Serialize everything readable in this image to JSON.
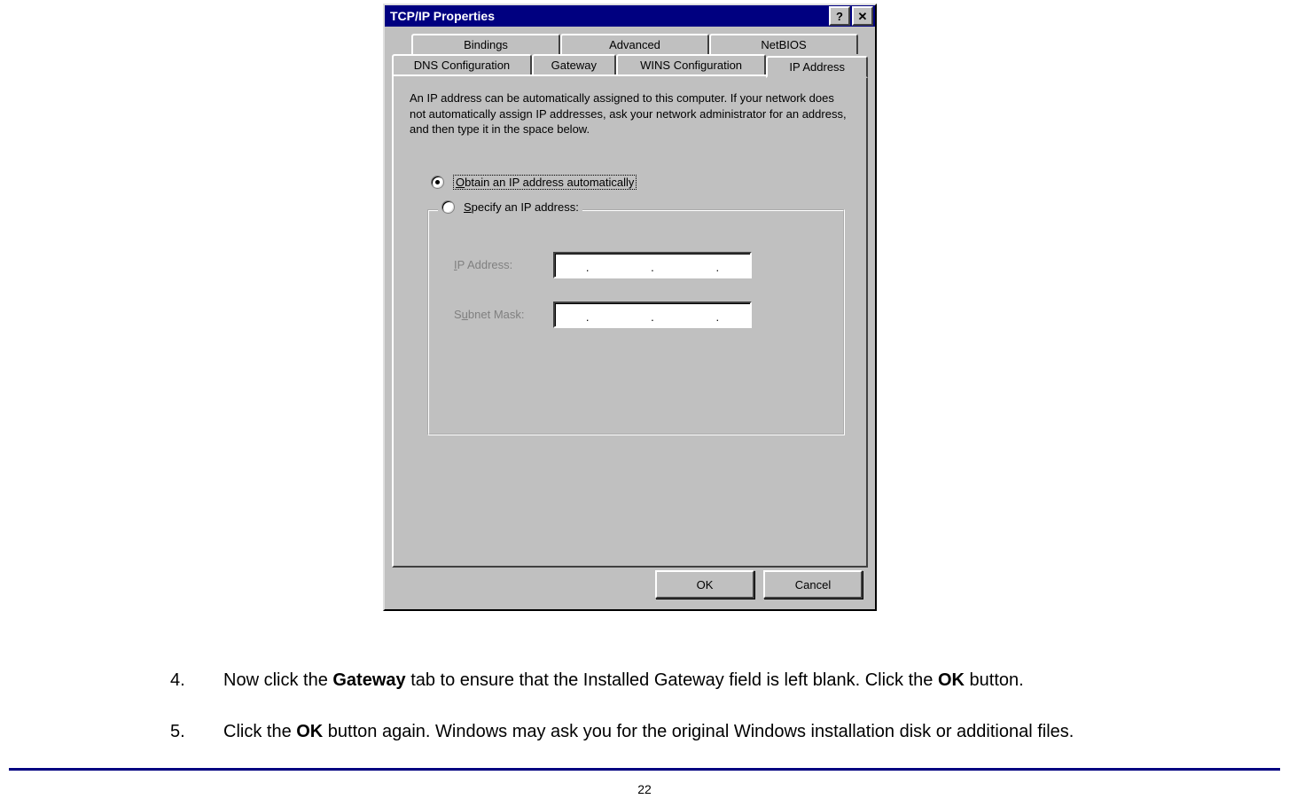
{
  "dialog": {
    "title": "TCP/IP Properties",
    "help_glyph": "?",
    "close_glyph": "✕",
    "tabs_row1": [
      "Bindings",
      "Advanced",
      "NetBIOS"
    ],
    "tabs_row2": [
      "DNS Configuration",
      "Gateway",
      "WINS Configuration",
      "IP Address"
    ],
    "active_tab": "IP Address",
    "description": "An IP address can be automatically assigned to this computer. If your network does not automatically assign IP addresses, ask your network administrator for an address, and then type it in the space below.",
    "radio_auto_prefix": "O",
    "radio_auto_rest": "btain an IP address automatically",
    "radio_specify_prefix": "S",
    "radio_specify_rest": "pecify an IP address:",
    "ip_label_prefix": "I",
    "ip_label_rest": "P Address:",
    "subnet_label_prefix": "u",
    "subnet_label_pre": "S",
    "subnet_label_rest": "bnet Mask:",
    "ok_label": "OK",
    "cancel_label": "Cancel"
  },
  "instructions": {
    "step4_num": "4.",
    "step4_a": "Now click the ",
    "step4_b": "Gateway",
    "step4_c": " tab to ensure that the Installed Gateway field is left blank. Click the ",
    "step4_d": "OK",
    "step4_e": " button.",
    "step5_num": "5.",
    "step5_a": "Click the ",
    "step5_b": "OK",
    "step5_c": " button again. Windows may ask you for the original Windows installation disk or additional files."
  },
  "page_number": "22"
}
